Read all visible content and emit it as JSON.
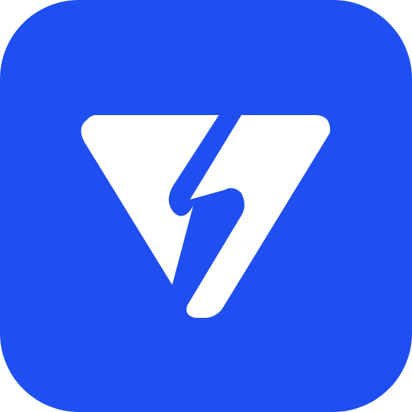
{
  "app_icon": {
    "background_color": "#1f4ff0",
    "glyph_color": "#ffffff",
    "glyph": "v-logo-icon"
  }
}
